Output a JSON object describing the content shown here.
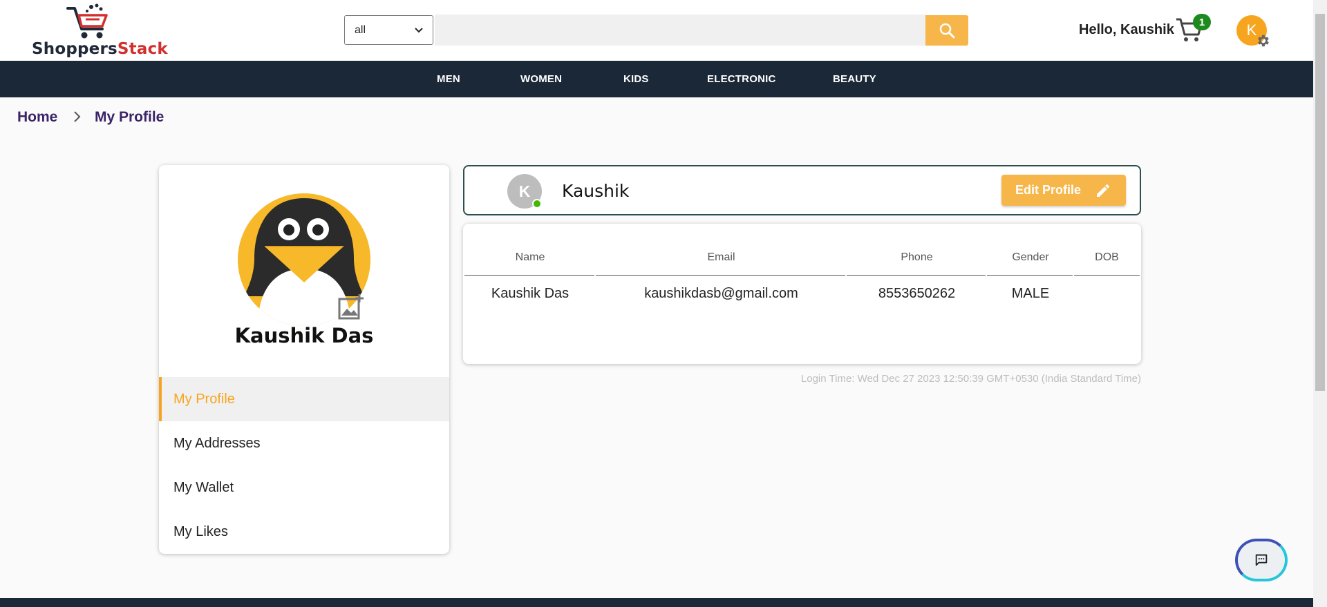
{
  "brand": {
    "part1": "Shoppers",
    "part2": "Stack"
  },
  "search": {
    "category": "all",
    "placeholder": ""
  },
  "header": {
    "greeting": "Hello, Kaushik",
    "cart_count": "1",
    "avatar_letter": "K"
  },
  "nav": {
    "items": [
      "MEN",
      "WOMEN",
      "KIDS",
      "ELECTRONIC",
      "BEAUTY"
    ]
  },
  "breadcrumb": {
    "home": "Home",
    "current": "My Profile"
  },
  "sidebar": {
    "name": "Kaushik Das",
    "menu": [
      "My Profile",
      "My Addresses",
      "My Wallet",
      "My Likes"
    ]
  },
  "profile": {
    "avatar_letter": "K",
    "display_name": "Kaushik",
    "edit_label": "Edit Profile"
  },
  "details": {
    "headers": [
      "Name",
      "Email",
      "Phone",
      "Gender",
      "DOB"
    ],
    "values": [
      "Kaushik Das",
      "kaushikdasb@gmail.com",
      "8553650262",
      "MALE",
      ""
    ]
  },
  "login_time": "Login Time: Wed Dec 27 2023 12:50:39 GMT+0530 (India Standard Time)",
  "colors": {
    "accent": "#f7b649",
    "nav_bg": "#1b2838",
    "crumb": "#3b2466",
    "online": "#44b700"
  }
}
